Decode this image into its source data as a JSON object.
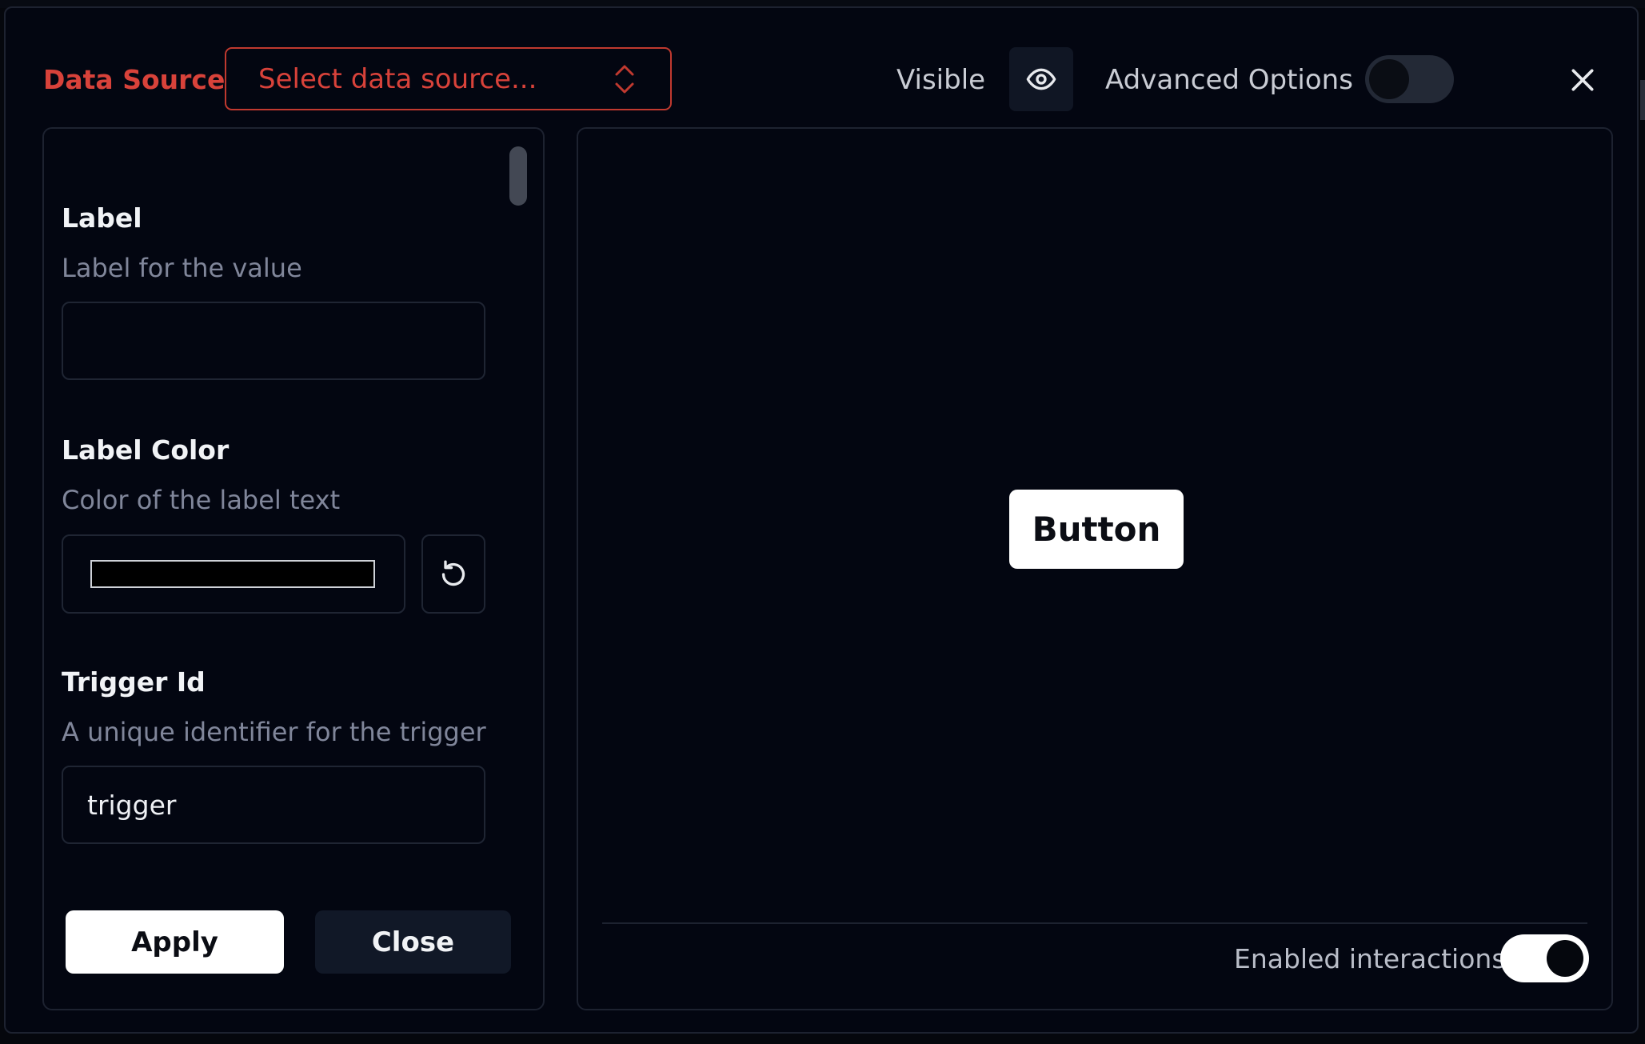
{
  "header": {
    "data_source_label": "Data Source:",
    "data_source_placeholder": "Select data source...",
    "visible_label": "Visible",
    "advanced_options_label": "Advanced Options",
    "advanced_options_enabled": false
  },
  "fields": {
    "label": {
      "title": "Label",
      "description": "Label for the value",
      "value": ""
    },
    "label_color": {
      "title": "Label Color",
      "description": "Color of the label text",
      "color": "#000000"
    },
    "trigger_id": {
      "title": "Trigger Id",
      "description": "A unique identifier for the trigger",
      "value": "trigger"
    }
  },
  "actions": {
    "apply_label": "Apply",
    "close_label": "Close"
  },
  "preview": {
    "button_label": "Button",
    "enabled_interactions_label": "Enabled interactions",
    "enabled_interactions": true
  },
  "colors": {
    "accent_error": "#d8423a",
    "background": "#030611",
    "border": "#1d2230"
  }
}
